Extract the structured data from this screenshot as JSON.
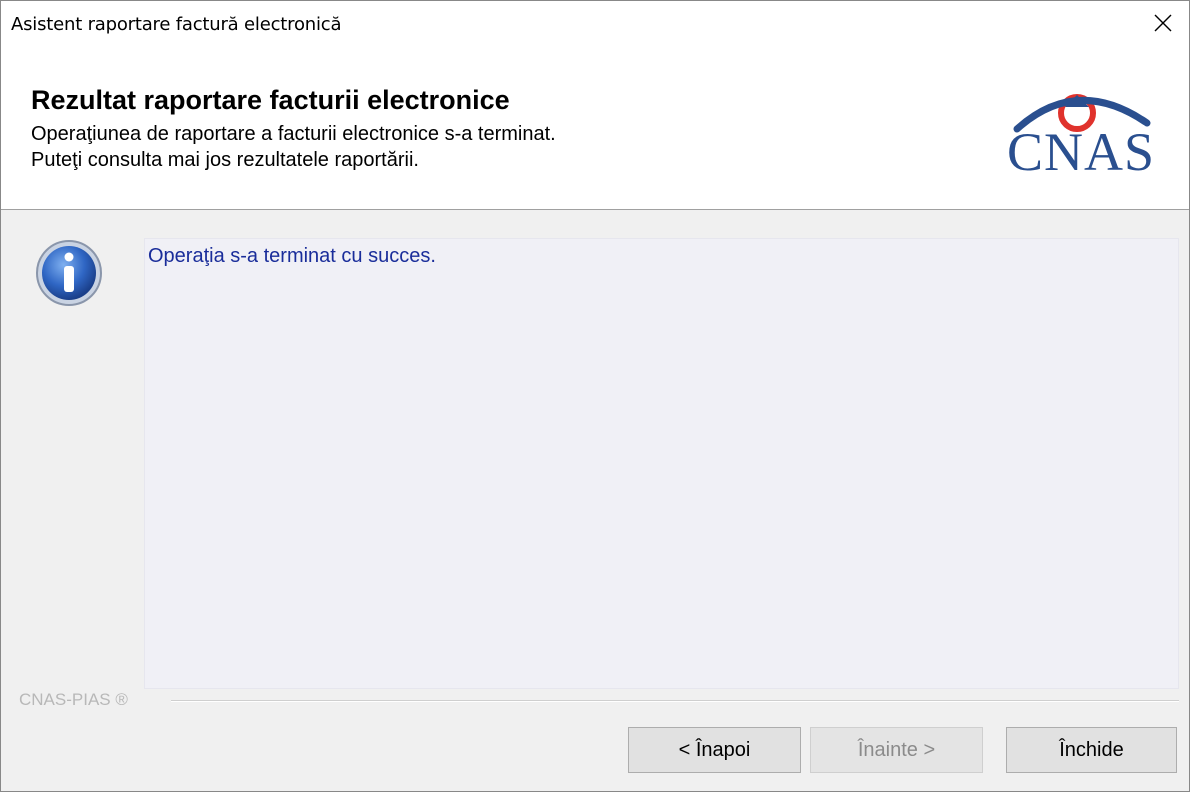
{
  "window": {
    "title": "Asistent raportare factură electronică"
  },
  "header": {
    "title": "Rezultat raportare facturii electronice",
    "line1": "Operaţiunea de raportare a facturii electronice s-a terminat.",
    "line2": "Puteţi consulta mai jos rezultatele raportării.",
    "logo_text": "CNAS"
  },
  "result": {
    "message": "Operaţia s-a terminat cu succes."
  },
  "footer": {
    "brand": "CNAS-PIAS ®",
    "back_label": "< Înapoi",
    "next_label": "Înainte >",
    "close_label": "Închide"
  },
  "icons": {
    "close": "close-icon",
    "info": "info-icon",
    "logo": "cnas-logo"
  },
  "colors": {
    "logo_blue": "#2a4f8f",
    "logo_red": "#e0322c",
    "message_text": "#1a2d9a"
  }
}
